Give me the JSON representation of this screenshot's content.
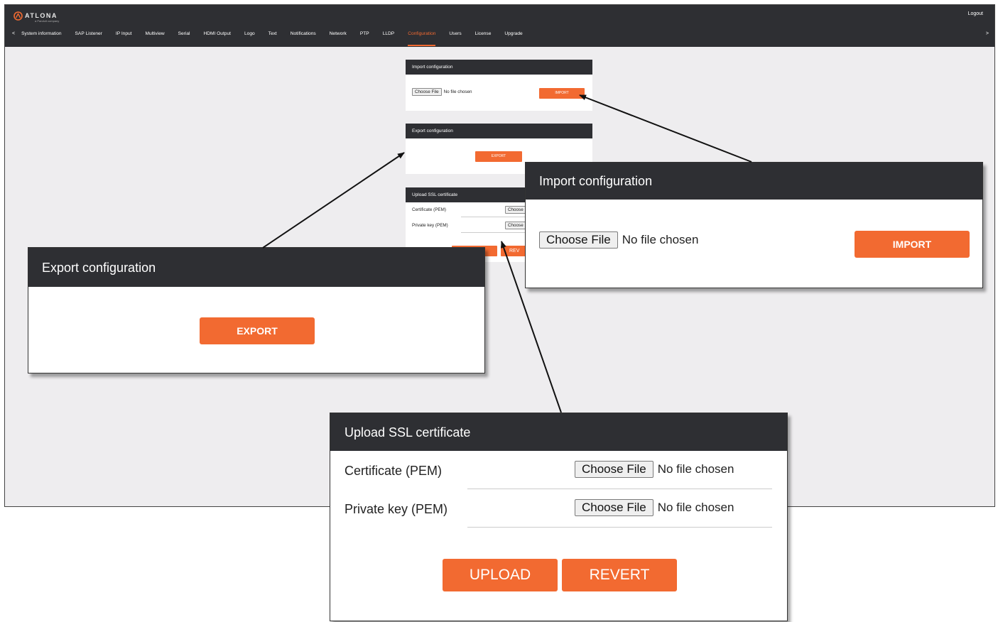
{
  "app": {
    "logo_text": "ATLONA",
    "logo_subtitle": "a Panduit company",
    "logout_label": "Logout",
    "nav_prev": "<",
    "nav_next": ">",
    "tabs": [
      "System information",
      "SAP Listener",
      "IP Input",
      "Multiview",
      "Serial",
      "HDMI Output",
      "Logo",
      "Text",
      "Notifications",
      "Network",
      "PTP",
      "LLDP",
      "Configuration",
      "Users",
      "License",
      "Upgrade"
    ],
    "active_tab": "Configuration"
  },
  "colors": {
    "accent": "#f26a31",
    "header_bg": "#2e2f33",
    "page_bg": "#eeedef"
  },
  "import": {
    "title": "Import configuration",
    "choose_file": "Choose File",
    "no_file": "No file chosen",
    "button": "IMPORT"
  },
  "export": {
    "title": "Export configuration",
    "button": "EXPORT"
  },
  "ssl": {
    "title": "Upload SSL certificate",
    "cert_label": "Certificate (PEM)",
    "key_label": "Private key (PEM)",
    "choose_file": "Choose File",
    "choose_short": "Choose",
    "no_file": "No file chosen",
    "upload": "UPLOAD",
    "revert": "REVERT",
    "revert_short": "REV"
  }
}
